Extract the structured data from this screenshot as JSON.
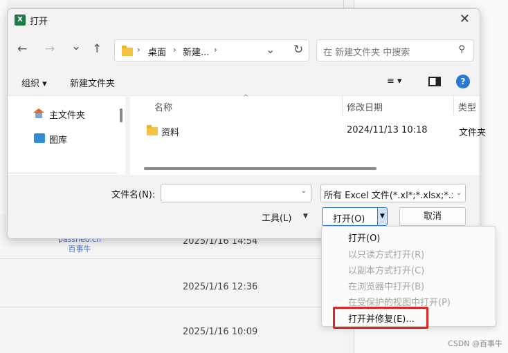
{
  "background": {
    "dates": [
      "2025/1/16 14:54",
      "2025/1/16 12:36",
      "2025/1/16 10:09"
    ],
    "watermark_line1": "passneo.cn",
    "watermark_line2": "百事牛",
    "credit": "CSDN @百事牛"
  },
  "dialog": {
    "title": "打开",
    "app_icon_letter": "X",
    "nav": {
      "back": "←",
      "forward": "→",
      "recent": "⌄",
      "up": "↑",
      "refresh": "↻",
      "breadcrumb": [
        "桌面",
        "新建..."
      ],
      "addr_dropdown": "⌄"
    },
    "search_placeholder": "在 新建文件夹 中搜索",
    "toolbar": {
      "organize": "组织 ▾",
      "new_folder": "新建文件夹",
      "view_icon": "≡ ▾",
      "help": "?"
    },
    "sidebar": [
      {
        "label": "主文件夹",
        "icon": "home-icon"
      },
      {
        "label": "图库",
        "icon": "gallery-icon"
      }
    ],
    "columns": [
      "名称",
      "修改日期",
      "类型"
    ],
    "files": [
      {
        "name": "资料",
        "modified": "2024/11/13 10:18",
        "type": "文件夹"
      }
    ],
    "filename_label": "文件名(N):",
    "filename_value": "",
    "filetype": "所有 Excel 文件(*.xl*;*.xlsx;*.xlsm",
    "tools_label": "工具(L)",
    "open_label": "打开(O)",
    "cancel_label": "取消"
  },
  "open_menu": [
    {
      "label": "打开(O)",
      "enabled": true
    },
    {
      "label": "以只读方式打开(R)",
      "enabled": false
    },
    {
      "label": "以副本方式打开(C)",
      "enabled": false
    },
    {
      "label": "在浏览器中打开(B)",
      "enabled": false
    },
    {
      "label": "在受保护的视图中打开(P)",
      "enabled": false
    },
    {
      "label": "打开并修复(E)...",
      "enabled": true,
      "highlighted": true
    }
  ],
  "colors": {
    "accent": "#2b79d6",
    "highlight": "#e02323",
    "excel_green": "#1d7a45"
  }
}
